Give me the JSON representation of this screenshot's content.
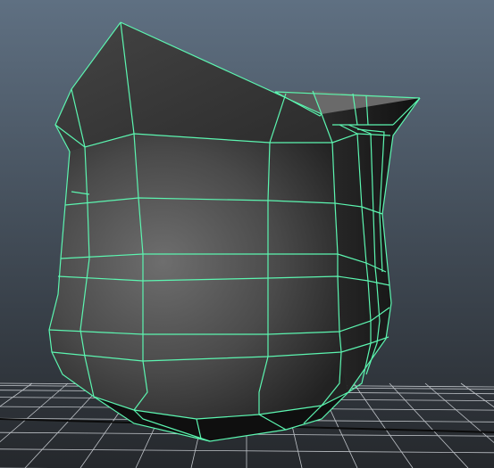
{
  "viewport": {
    "background_top": "#5f7082",
    "background_bottom": "#25282c",
    "grid_color": "#bfc3c8",
    "grid_center_color": "#0b0b0b",
    "wireframe_color": "#5cf5b0",
    "mesh_shade_light": "#8a8a8a",
    "mesh_shade_dark": "#1a1a1a"
  }
}
